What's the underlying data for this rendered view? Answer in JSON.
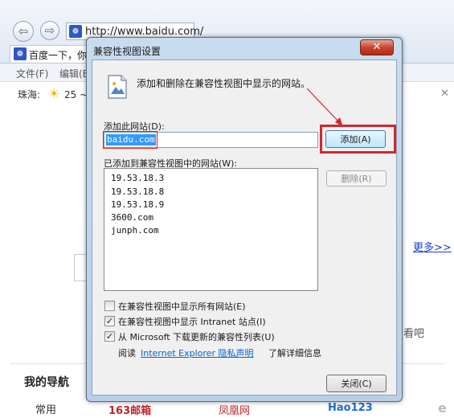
{
  "browser": {
    "url": "http://www.baidu.com/",
    "tab_title": "百度一下，你",
    "menu": [
      "文件(F)",
      "编辑(E)"
    ],
    "weather_city": "珠海:",
    "weather_temp": "25 ~",
    "more_link": "更多>>",
    "side_text": "看吧",
    "my_nav": "我的导航",
    "common": "常用",
    "site_163": "163邮箱",
    "site_fh": "凤凰网",
    "site_hao": "Hao123"
  },
  "dialog": {
    "title": "兼容性视图设置",
    "close_glyph": "✕",
    "intro": "添加和删除在兼容性视图中显示的网站。",
    "add_site_label": "添加此网站(D):",
    "add_site_value": "baidu.com",
    "add_button": "添加(A)",
    "list_label": "已添加到兼容性视图中的网站(W):",
    "sites": [
      "19.53.18.3",
      "19.53.18.8",
      "19.53.18.9",
      "3600.com",
      "junph.com"
    ],
    "delete_button": "删除(R)",
    "options": [
      {
        "label": "在兼容性视图中显示所有网站(E)",
        "checked": false
      },
      {
        "label": "在兼容性视图中显示 Intranet 站点(I)",
        "checked": true
      },
      {
        "label": "从 Microsoft 下载更新的兼容性列表(U)",
        "checked": true
      }
    ],
    "read_prefix": "阅读",
    "privacy_link": "Internet Explorer 隐私声明",
    "read_suffix": "了解详细信息",
    "close_button": "关闭(C)"
  },
  "colors": {
    "highlight": "#d3272f",
    "link": "#0066cc"
  }
}
